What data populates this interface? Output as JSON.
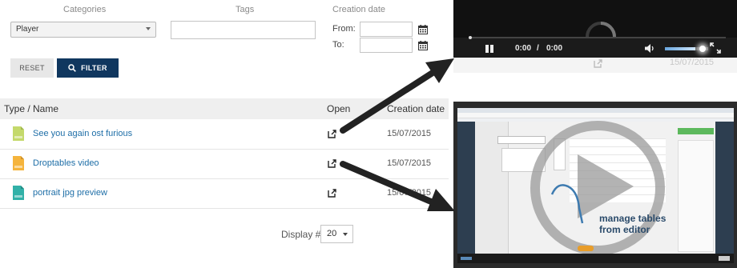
{
  "filters": {
    "categories_label": "Categories",
    "tags_label": "Tags",
    "creation_date_label": "Creation date",
    "category_value": "Player",
    "from_label": "From:",
    "to_label": "To:",
    "reset_label": "RESET",
    "filter_label": "FILTER"
  },
  "table": {
    "headers": {
      "type_name": "Type / Name",
      "open": "Open",
      "creation_date": "Creation date"
    },
    "rows": [
      {
        "name": "See you again ost furious",
        "date": "15/07/2015",
        "type": "mp3",
        "color": "#c4d96b"
      },
      {
        "name": "Droptables video",
        "date": "15/07/2015",
        "type": "mp4",
        "color": "#f5b43c"
      },
      {
        "name": "portrait jpg preview",
        "date": "15/07/2015",
        "type": "jpg",
        "color": "#32b1a8"
      }
    ]
  },
  "pagination": {
    "display_label": "Display #",
    "display_value": "20"
  },
  "player1": {
    "current_time": "0:00",
    "separator": "/",
    "duration": "0:00",
    "behind_date": "15/07/2015",
    "volume_level": 0.7
  },
  "player2": {
    "caption_line1": "manage tables",
    "caption_line2": "from editor"
  },
  "colors": {
    "filter_button": "#10375f",
    "link": "#1e6ea7",
    "table_header": "#efefef"
  }
}
